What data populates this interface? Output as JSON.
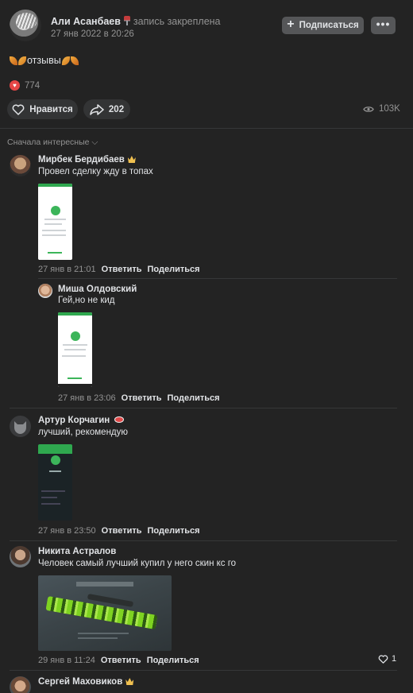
{
  "post": {
    "author": "Али Асанбаев",
    "pinned_note": "запись закреплена",
    "date": "27 янв 2022 в 20:26",
    "subscribe_label": "Подписаться",
    "more_label": "•••",
    "text": "отзывы",
    "reactions_count": "774",
    "like_label": "Нравится",
    "shares_count": "202",
    "views_count": "103K"
  },
  "sort": {
    "label": "Сначала интересные"
  },
  "comments": [
    {
      "author": "Мирбек Бердибаев",
      "text": "Провел сделку жду в топах",
      "date": "27 янв в 21:01",
      "reply_label": "Ответить",
      "share_label": "Поделиться",
      "replies": [
        {
          "author": "Миша Олдовский",
          "text": "Гей,но не кид",
          "date": "27 янв в 23:06",
          "reply_label": "Ответить",
          "share_label": "Поделиться"
        }
      ]
    },
    {
      "author": "Артур Корчагин",
      "text": "лучший, рекомендую",
      "date": "27 янв в 23:50",
      "reply_label": "Ответить",
      "share_label": "Поделиться"
    },
    {
      "author": "Никита Астралов",
      "text": "Человек самый лучший купил у него скин кс го",
      "date": "29 янв в 11:24",
      "reply_label": "Ответить",
      "share_label": "Поделиться",
      "likes": "1"
    },
    {
      "author": "Сергей Маховиков"
    }
  ],
  "colors": {
    "background": "#232323",
    "button": "#555658",
    "pill": "#333435",
    "secondary_text": "#939393",
    "reaction": "#e64646"
  }
}
